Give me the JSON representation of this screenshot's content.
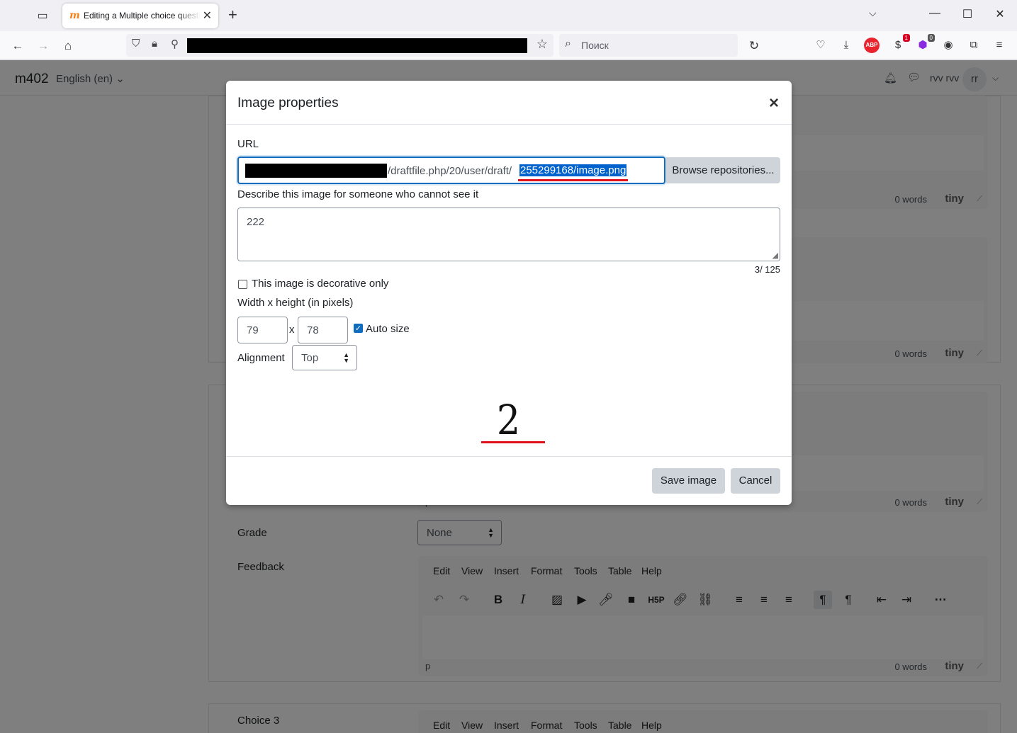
{
  "browser": {
    "tab_title": "Editing a Multiple choice question",
    "search_placeholder": "Поиск",
    "ext_abp": "ABP",
    "badge_1": "1",
    "badge_2": "0"
  },
  "site": {
    "name": "m402",
    "language": "English (en) ⌄",
    "user_name": "rvv rvv",
    "user_initials": "rr"
  },
  "editor": {
    "menu": [
      "Edit",
      "View",
      "Insert",
      "Format",
      "Tools",
      "Table",
      "Help"
    ],
    "status_path": "p",
    "word_count": "0 words",
    "brand": "tiny"
  },
  "form": {
    "grade_label": "Grade",
    "grade_value": "None",
    "feedback_label": "Feedback",
    "choice3_label": "Choice 3"
  },
  "modal": {
    "title": "Image properties",
    "url_label": "URL",
    "url_plain": "/draftfile.php/20/user/draft/",
    "url_selected": "255299168/image.png",
    "browse_button": "Browse repositories...",
    "alt_label": "Describe this image for someone who cannot see it",
    "alt_value": "222",
    "alt_counter": "3/ 125",
    "decorative_label": "This image is decorative only",
    "size_label": "Width x height (in pixels)",
    "width": "79",
    "height": "78",
    "size_sep": "x",
    "auto_size_label": "Auto size",
    "alignment_label": "Alignment",
    "alignment_value": "Top",
    "save_button": "Save image",
    "cancel_button": "Cancel"
  },
  "colors": {
    "accent": "#0f6cbf",
    "annotation_red": "#e0101b",
    "button_grey": "#ced4da"
  },
  "icons": [
    "list-all-tabs-icon",
    "moodle-favicon",
    "close-tab-icon",
    "new-tab-icon",
    "tabs-dropdown-icon",
    "minimize-icon",
    "maximize-icon",
    "close-window-icon",
    "back-icon",
    "forward-icon",
    "home-icon",
    "shield-icon",
    "lock-icon",
    "permissions-icon",
    "bookmark-star-icon",
    "search-icon",
    "reload-icon",
    "pocket-icon",
    "download-icon",
    "abp-icon",
    "extension-icon",
    "account-icon",
    "puzzle-icon",
    "menu-icon",
    "bell-icon",
    "chat-icon",
    "chevron-down-icon"
  ]
}
